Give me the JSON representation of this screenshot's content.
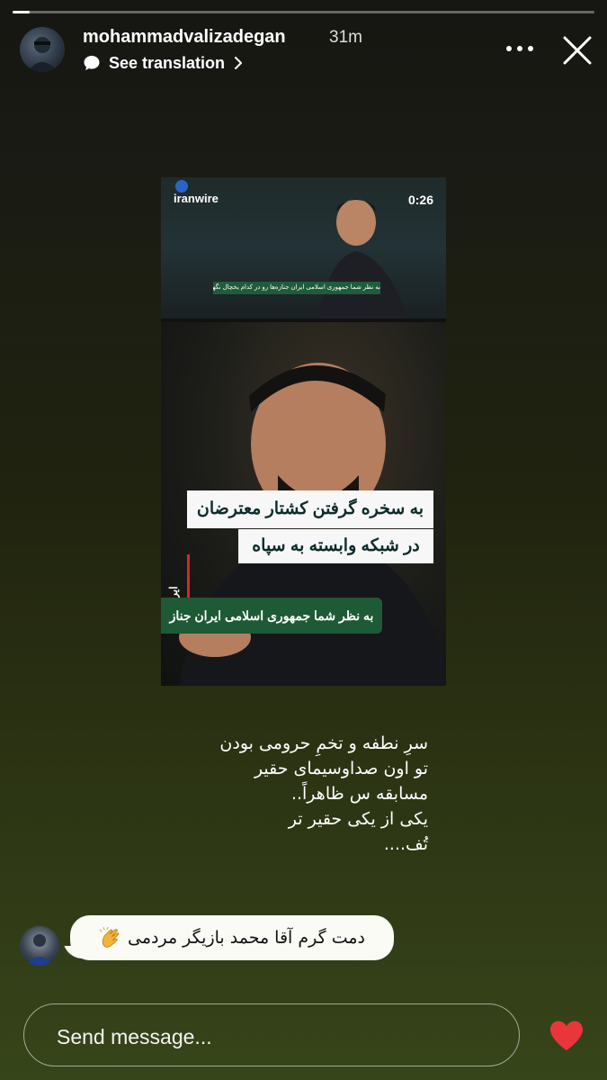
{
  "story": {
    "progress": 0.03,
    "username": "mohammadvalizadegan",
    "time_ago": "31m",
    "translate_label": "See translation"
  },
  "media": {
    "brand": "iranwire",
    "duration": "0:26",
    "vertical_brand": "ایران‌وایر",
    "headline_line1": "به سخره گرفتن کشتار معترضان",
    "headline_line2": "در شبکه وابسته به سپاه",
    "green_caption": "به نظر شما جمهوری اسلامی ایران جناز",
    "strip_caption": "به نظر شما جمهوری اسلامی ایران جنازه‌ها رو در کدام یخچال نگهداری می کند؟"
  },
  "overlay_text": {
    "lines": [
      "سرِ نطفه و تخمِ حرومی بودن",
      "تو اون صداوسیمای حقیر",
      "مسابقه س ظاهراً..",
      "یکی از یکی حقیر تر",
      "تُف...."
    ]
  },
  "reply": {
    "text": "دمت گرم آقا محمد بازیگر مردمی"
  },
  "composer": {
    "placeholder": "Send message..."
  },
  "colors": {
    "heart": "#e9363a",
    "caption_green": "#1e5a36"
  },
  "icons": [
    "chat-bubble-icon",
    "chevron-right-icon",
    "more-icon",
    "close-icon",
    "clapping-hands-icon",
    "heart-icon"
  ]
}
